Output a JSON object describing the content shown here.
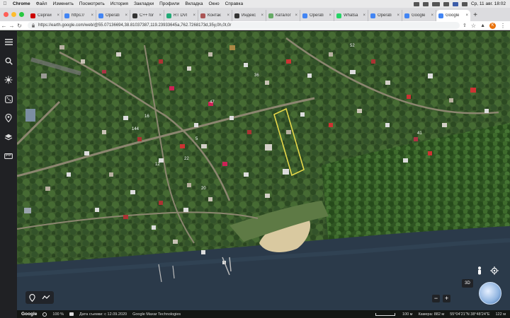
{
  "menubar": {
    "app": "Chrome",
    "items": [
      "Файл",
      "Изменить",
      "Посмотреть",
      "История",
      "Закладки",
      "Профили",
      "Вкладка",
      "Окно",
      "Справка"
    ],
    "clock": "Ср, 11 авг.  18:02"
  },
  "tabs": [
    {
      "title": "Сергей",
      "favicon": "#c00"
    },
    {
      "title": "https://",
      "favicon": "#4285f4"
    },
    {
      "title": "Operati",
      "favicon": "#4285f4"
    },
    {
      "title": "C++ for",
      "favicon": "#333"
    },
    {
      "title": "RT DVI",
      "favicon": "#2a7"
    },
    {
      "title": "Контак",
      "favicon": "#a55"
    },
    {
      "title": "Индекс",
      "favicon": "#333"
    },
    {
      "title": "Каталог",
      "favicon": "#6a6"
    },
    {
      "title": "Operati",
      "favicon": "#4285f4"
    },
    {
      "title": "Whatsa",
      "favicon": "#25d366"
    },
    {
      "title": "Operati",
      "favicon": "#4285f4"
    },
    {
      "title": "Google",
      "favicon": "#4285f4"
    },
    {
      "title": "Google",
      "favicon": "#4285f4",
      "active": true
    }
  ],
  "address": {
    "url": "https://earth.google.com/web/@55.07136694,38.81037387,119.23933645a,762.7268173d,35y,0h,0t,0r",
    "profile_letter": "К"
  },
  "map": {
    "labels": [
      "52",
      "36",
      "41",
      "47",
      "144",
      "12",
      "5",
      "16",
      "22",
      "20"
    ]
  },
  "status": {
    "logo": "Google",
    "zoom": "100 %",
    "capture_date": "Дата съемки: с 12.09.2020",
    "attribution": "Google   Maxar Technologies",
    "scale": "100 м",
    "camera": "Камера: 882 м",
    "coords": "55°04'21\"N 38°48'24\"E",
    "elevation": "122 м"
  },
  "controls": {
    "btn3d": "3D",
    "zoom_out": "−",
    "zoom_in": "+"
  },
  "colors": {
    "property_outline": "#e6d84a",
    "river": "#2b3a4a",
    "sand": "#d9c9a0"
  }
}
